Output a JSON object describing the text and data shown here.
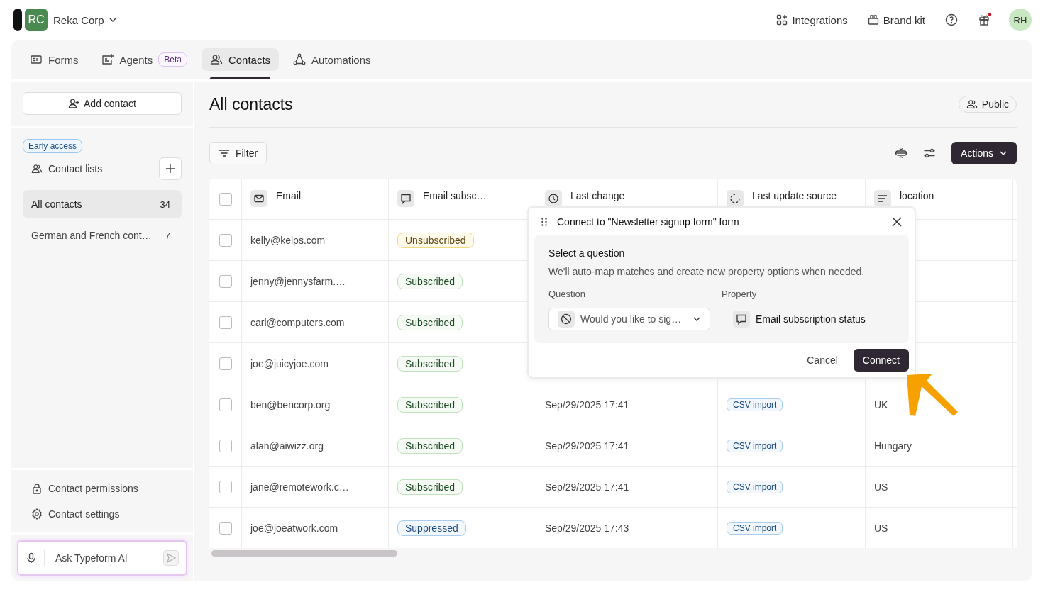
{
  "workspace": {
    "initials": "RC",
    "name": "Reka Corp"
  },
  "top_links": [
    {
      "kind": "integrations",
      "label": "Integrations"
    },
    {
      "kind": "brand",
      "label": "Brand kit"
    }
  ],
  "user": {
    "initials": "RH"
  },
  "tabs": [
    {
      "kind": "forms",
      "label": "Forms",
      "selected": false
    },
    {
      "kind": "agents",
      "label": "Agents",
      "badge": "Beta",
      "selected": false
    },
    {
      "kind": "contacts",
      "label": "Contacts",
      "selected": true
    },
    {
      "kind": "automations",
      "label": "Automations",
      "selected": false
    }
  ],
  "sidebar": {
    "add_button": "Add contact",
    "badge": "Early access",
    "section": "Contact lists",
    "lists": [
      {
        "label": "All contacts",
        "count": "34",
        "selected": true
      },
      {
        "label": "German and French cont…",
        "count": "7",
        "selected": false
      }
    ],
    "footer_links": [
      {
        "kind": "lock",
        "label": "Contact permissions"
      },
      {
        "kind": "gear",
        "label": "Contact settings"
      }
    ],
    "ai_placeholder": "Ask Typeform AI"
  },
  "page": {
    "title": "All contacts",
    "visibility": "Public",
    "filter": "Filter",
    "actions": "Actions"
  },
  "table": {
    "select_all_checked": false,
    "columns": [
      {
        "kind": "mail",
        "label": "Email"
      },
      {
        "kind": "chat",
        "label": "Email subsc…"
      },
      {
        "kind": "clock",
        "label": "Last change"
      },
      {
        "kind": "source",
        "label": "Last update source"
      },
      {
        "kind": "text",
        "label": "location"
      }
    ],
    "rows": [
      {
        "checked": false,
        "email": "kelly@kelps.com",
        "status": {
          "label": "Unsubscribed",
          "kind": "unsubscribed"
        }
      },
      {
        "checked": false,
        "email": "jenny@jennysfarm.…",
        "status": {
          "label": "Subscribed",
          "kind": "subscribed"
        }
      },
      {
        "checked": false,
        "email": "carl@computers.com",
        "status": {
          "label": "Subscribed",
          "kind": "subscribed"
        }
      },
      {
        "checked": false,
        "email": "joe@juicyjoe.com",
        "status": {
          "label": "Subscribed",
          "kind": "subscribed"
        }
      },
      {
        "checked": false,
        "email": "ben@bencorp.org",
        "status": {
          "label": "Subscribed",
          "kind": "subscribed"
        },
        "last_change": "Sep/29/2025 17:41",
        "source": "CSV import",
        "location": "UK"
      },
      {
        "checked": false,
        "email": "alan@aiwizz.org",
        "status": {
          "label": "Subscribed",
          "kind": "subscribed"
        },
        "last_change": "Sep/29/2025 17:41",
        "source": "CSV import",
        "location": "Hungary"
      },
      {
        "checked": false,
        "email": "jane@remotework.c…",
        "status": {
          "label": "Subscribed",
          "kind": "subscribed"
        },
        "last_change": "Sep/29/2025 17:41",
        "source": "CSV import",
        "location": "US"
      },
      {
        "checked": false,
        "email": "joe@joeatwork.com",
        "status": {
          "label": "Suppressed",
          "kind": "suppressed"
        },
        "last_change": "Sep/29/2025 17:43",
        "source": "CSV import",
        "location": "US"
      }
    ]
  },
  "popover": {
    "title": "Connect to \"Newsletter signup form\" form",
    "heading": "Select a question",
    "description": "We'll auto-map matches and create new property options when needed.",
    "question_label": "Question",
    "question_value": "Would you like to sig…",
    "property_label": "Property",
    "property_value": "Email subscription status",
    "cancel": "Cancel",
    "confirm": "Connect"
  }
}
